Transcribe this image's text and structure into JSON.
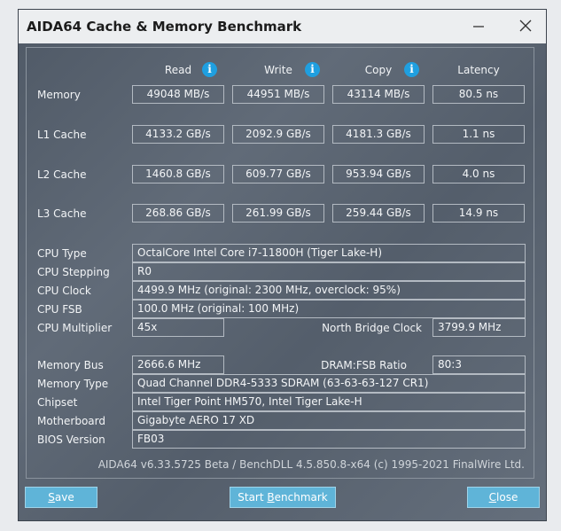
{
  "window": {
    "title": "AIDA64 Cache & Memory Benchmark",
    "minimize_glyph": "—",
    "close_glyph": "✕"
  },
  "headers": {
    "read": "Read",
    "write": "Write",
    "copy": "Copy",
    "latency": "Latency",
    "info_glyph": "i"
  },
  "bench_rows": [
    {
      "label": "Memory",
      "read": "49048 MB/s",
      "write": "44951 MB/s",
      "copy": "43114 MB/s",
      "latency": "80.5 ns"
    },
    {
      "label": "L1 Cache",
      "read": "4133.2 GB/s",
      "write": "2092.9 GB/s",
      "copy": "4181.3 GB/s",
      "latency": "1.1 ns"
    },
    {
      "label": "L2 Cache",
      "read": "1460.8 GB/s",
      "write": "609.77 GB/s",
      "copy": "953.94 GB/s",
      "latency": "4.0 ns"
    },
    {
      "label": "L3 Cache",
      "read": "268.86 GB/s",
      "write": "261.99 GB/s",
      "copy": "259.44 GB/s",
      "latency": "14.9 ns"
    }
  ],
  "cpu": {
    "type_label": "CPU Type",
    "type_value": "OctalCore Intel Core i7-11800H  (Tiger Lake-H)",
    "stepping_label": "CPU Stepping",
    "stepping_value": "R0",
    "clock_label": "CPU Clock",
    "clock_value": "4499.9 MHz  (original: 2300 MHz, overclock: 95%)",
    "fsb_label": "CPU FSB",
    "fsb_value": "100.0 MHz  (original: 100 MHz)",
    "multiplier_label": "CPU Multiplier",
    "multiplier_value": "45x",
    "nb_clock_label": "North Bridge Clock",
    "nb_clock_value": "3799.9 MHz"
  },
  "memory": {
    "bus_label": "Memory Bus",
    "bus_value": "2666.6 MHz",
    "ratio_label": "DRAM:FSB Ratio",
    "ratio_value": "80:3",
    "type_label": "Memory Type",
    "type_value": "Quad Channel DDR4-5333 SDRAM  (63-63-63-127 CR1)",
    "chipset_label": "Chipset",
    "chipset_value": "Intel Tiger Point HM570, Intel Tiger Lake-H",
    "motherboard_label": "Motherboard",
    "motherboard_value": "Gigabyte AERO 17 XD",
    "bios_label": "BIOS Version",
    "bios_value": "FB03"
  },
  "footer": "AIDA64 v6.33.5725 Beta / BenchDLL 4.5.850.8-x64  (c) 1995-2021 FinalWire Ltd.",
  "buttons": {
    "save_u": "S",
    "save_rest": "ave",
    "start_pre": "Start ",
    "start_u": "B",
    "start_rest": "enchmark",
    "close_u": "C",
    "close_rest": "lose"
  },
  "colors": {
    "info_icon": "#1f9fe0",
    "button": "#5fb4d8",
    "panel_bg": "#59636f"
  }
}
